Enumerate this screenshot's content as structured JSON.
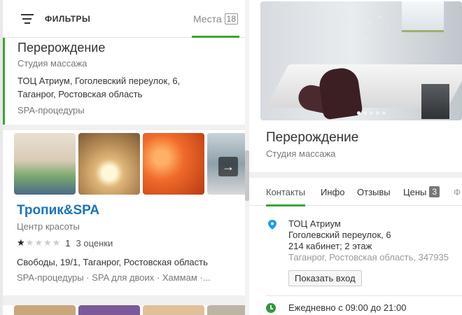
{
  "left": {
    "filters_label": "ФИЛЬТРЫ",
    "places_tab": {
      "label": "Места",
      "count": "18"
    },
    "cards": [
      {
        "title": "Перерождение",
        "subtitle": "Студия массажа",
        "address_line1": "ТОЦ Атриум, Гоголевский переулок, 6,",
        "address_line2": "Таганрог, Ростовская область",
        "tags": "SPA-процедуры"
      },
      {
        "title": "Тропик&SPA",
        "subtitle": "Центр красоты",
        "rating": 1,
        "rating_label": "1",
        "reviews_label": "3 оценки",
        "address": "Свободы, 19/1, Таганрог, Ростовская область",
        "tags": "SPA-процедуры · SPA для двоих · Хаммам ·..."
      }
    ],
    "arrow_glyph": "→"
  },
  "right": {
    "title": "Перерождение",
    "subtitle": "Студия массажа",
    "tabs": [
      {
        "label": "Контакты"
      },
      {
        "label": "Инфо"
      },
      {
        "label": "Отзывы"
      },
      {
        "label": "Цены",
        "badge": "3"
      },
      {
        "label": "Ф"
      }
    ],
    "address": {
      "line1": "ТОЦ Атриум",
      "line2": "Гоголевский переулок, 6",
      "line3": "214 кабинет; 2 этаж",
      "line4": "Таганрог, Ростовская область, 347935"
    },
    "entrance_button": "Показать вход",
    "hours": "Ежедневно с 09:00 до 21:00"
  },
  "colors": {
    "accent_green": "#3aa536",
    "link_blue": "#1a73b8",
    "pin_blue": "#1e9be9",
    "clock_green": "#2e9b38"
  },
  "icons": [
    "filter-icon",
    "arrow-right-icon",
    "map-pin-icon",
    "clock-icon",
    "star-icon"
  ]
}
